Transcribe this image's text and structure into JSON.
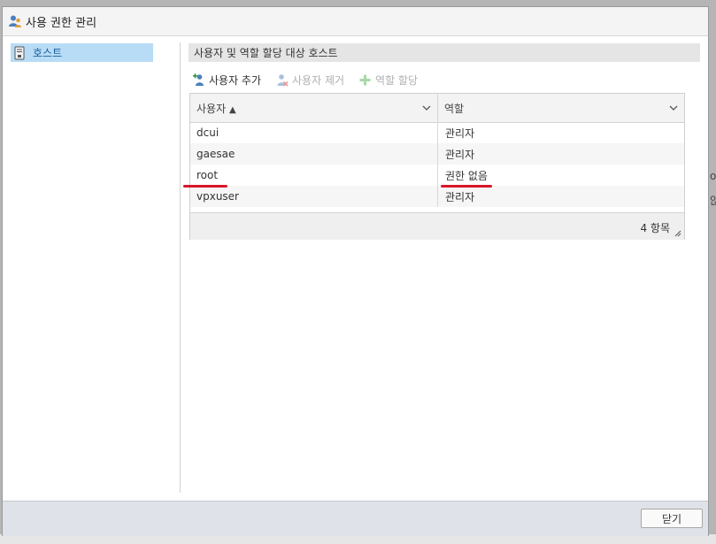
{
  "dialog": {
    "title": "사용 권한 관리",
    "icon": "users-icon",
    "close_label": "닫기"
  },
  "sidebar": {
    "items": [
      {
        "label": "호스트",
        "icon": "host-server-icon",
        "selected": true
      }
    ]
  },
  "panel": {
    "header": "사용자 및 역할 할당 대상 호스트"
  },
  "toolbar": {
    "add_user": {
      "label": "사용자 추가",
      "icon": "add-user-icon",
      "enabled": true
    },
    "remove_user": {
      "label": "사용자 제거",
      "icon": "remove-user-icon",
      "enabled": false
    },
    "assign_role": {
      "label": "역할 할당",
      "icon": "plus-icon",
      "enabled": false
    }
  },
  "grid": {
    "columns": [
      {
        "label": "사용자",
        "sort_indicator": "▲"
      },
      {
        "label": "역할"
      }
    ],
    "rows": [
      {
        "user": "dcui",
        "role": "관리자"
      },
      {
        "user": "gaesae",
        "role": "관리자"
      },
      {
        "user": "root",
        "role": "권한 없음"
      },
      {
        "user": "vpxuser",
        "role": "관리자"
      }
    ],
    "footer_count": "4 항목"
  },
  "colors": {
    "selected_item_bg": "#b8dcf5",
    "highlight_mark": "#d8152a",
    "footer_bg": "#dfe2e8"
  }
}
